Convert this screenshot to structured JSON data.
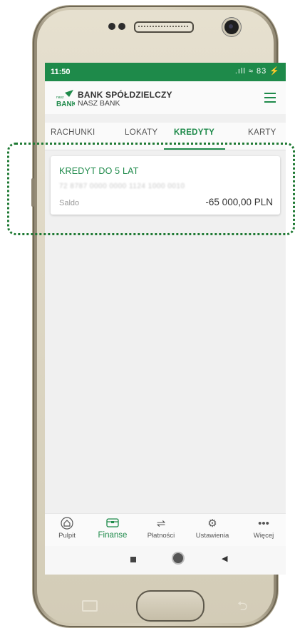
{
  "status_bar": {
    "time": "11:50",
    "icons": ".ıll ≈ 83 ⚡"
  },
  "header": {
    "logo_small": "nasz",
    "logo_big": "BANK",
    "bank_name": "BANK SPÓŁDZIELCZY",
    "bank_subtitle": "NASZ BANK"
  },
  "tabs": [
    {
      "label": "RACHUNKI"
    },
    {
      "label": "LOKATY"
    },
    {
      "label": "KREDYTY"
    },
    {
      "label": "KARTY"
    }
  ],
  "active_tab": "KREDYTY",
  "loan": {
    "title": "KREDYT DO 5 LAT",
    "account_number": "72 8787 0000 0000 1124 1000 0010",
    "balance_label": "Saldo",
    "balance": "-65 000,00 PLN"
  },
  "bottom_nav": [
    {
      "label": "Pulpit",
      "icon": "home-icon"
    },
    {
      "label": "Finanse",
      "icon": "wallet-icon"
    },
    {
      "label": "Płatności",
      "icon": "transfer-arrows-icon"
    },
    {
      "label": "Ustawienia",
      "icon": "gear-icon"
    },
    {
      "label": "Więcej",
      "icon": "more-dots-icon"
    }
  ],
  "active_nav": "Finanse",
  "colors": {
    "brand_green": "#1e8a4a",
    "highlight_green": "#1f7a34",
    "background": "#f0f0f0"
  }
}
